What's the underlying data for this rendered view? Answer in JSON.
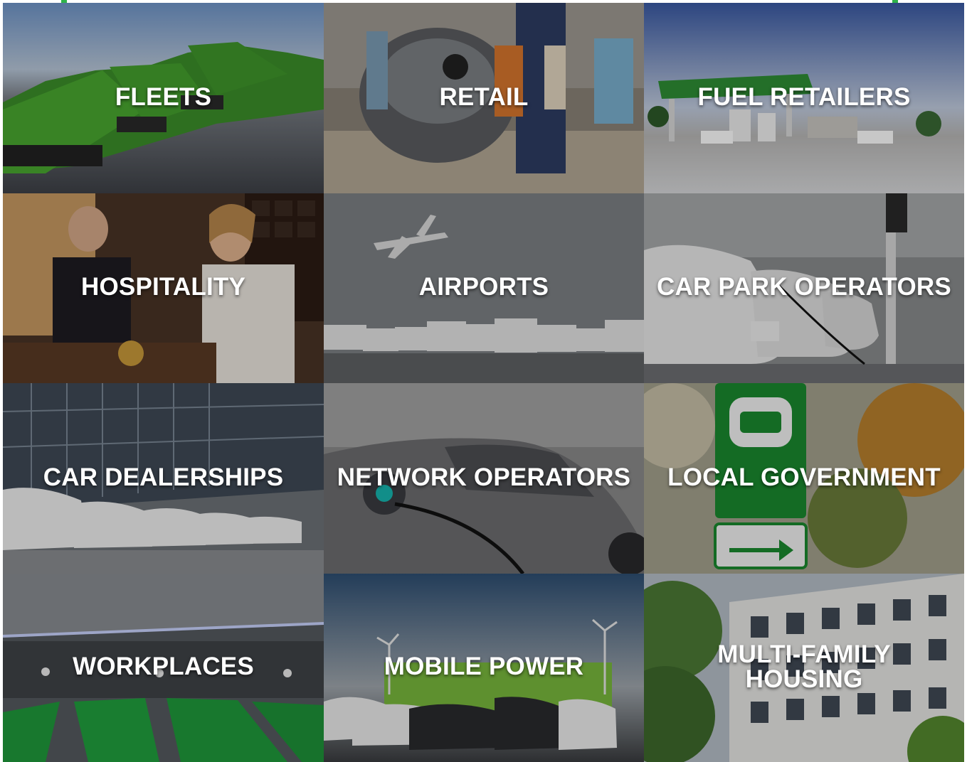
{
  "accent_color": "#2fb34a",
  "tiles": [
    {
      "label": "FLEETS",
      "scene": "fleets",
      "icon": "van-fleet-image"
    },
    {
      "label": "RETAIL",
      "scene": "retail",
      "icon": "shopping-charging-image"
    },
    {
      "label": "FUEL RETAILERS",
      "scene": "fuel",
      "icon": "fuel-station-image"
    },
    {
      "label": "HOSPITALITY",
      "scene": "hospitality",
      "icon": "hotel-reception-image"
    },
    {
      "label": "AIRPORTS",
      "scene": "airports",
      "icon": "airplane-buses-image"
    },
    {
      "label": "CAR PARK OPERATORS",
      "scene": "carpark",
      "icon": "charging-cars-image"
    },
    {
      "label": "CAR DEALERSHIPS",
      "scene": "dealership",
      "icon": "dealership-cars-image"
    },
    {
      "label": "NETWORK OPERATORS",
      "scene": "network",
      "icon": "ev-plug-image"
    },
    {
      "label": "LOCAL GOVERNMENT",
      "scene": "government",
      "icon": "ev-sign-image"
    },
    {
      "label": "WORKPLACES",
      "scene": "workplace",
      "icon": "garage-bays-image"
    },
    {
      "label": "MOBILE POWER",
      "scene": "mobile",
      "icon": "wind-turbine-container-image"
    },
    {
      "label": "MULTI-FAMILY\nHOUSING",
      "scene": "housing",
      "icon": "apartment-building-image"
    }
  ]
}
